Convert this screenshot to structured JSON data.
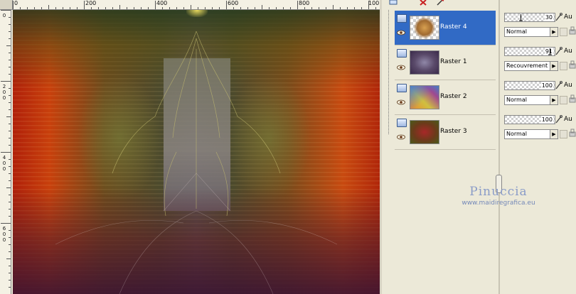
{
  "ruler": {
    "top_labels": [
      "0",
      "200",
      "400",
      "600",
      "800",
      "100"
    ],
    "left_labels": [
      "0",
      "200",
      "400",
      "600"
    ]
  },
  "layers": [
    {
      "name": "Raster 4",
      "selected": true,
      "opacity": "30",
      "blend": "Normal"
    },
    {
      "name": "Raster 1",
      "selected": false,
      "opacity": "91",
      "blend": "Recouvrement"
    },
    {
      "name": "Raster 2",
      "selected": false,
      "opacity": "100",
      "blend": "Normal"
    },
    {
      "name": "Raster 3",
      "selected": false,
      "opacity": "100",
      "blend": "Normal"
    }
  ],
  "props_label": "Au",
  "watermark": {
    "title": "Pinuccia",
    "url": "www.maidiregrafica.eu"
  },
  "colors": {
    "selection": "#316ac5",
    "panel": "#ece9d8"
  },
  "icons": [
    "layer-type-icon",
    "eye-icon",
    "lock-icon",
    "opacity-slider-icon",
    "dropdown-arrow-icon",
    "delete-layer-icon"
  ]
}
